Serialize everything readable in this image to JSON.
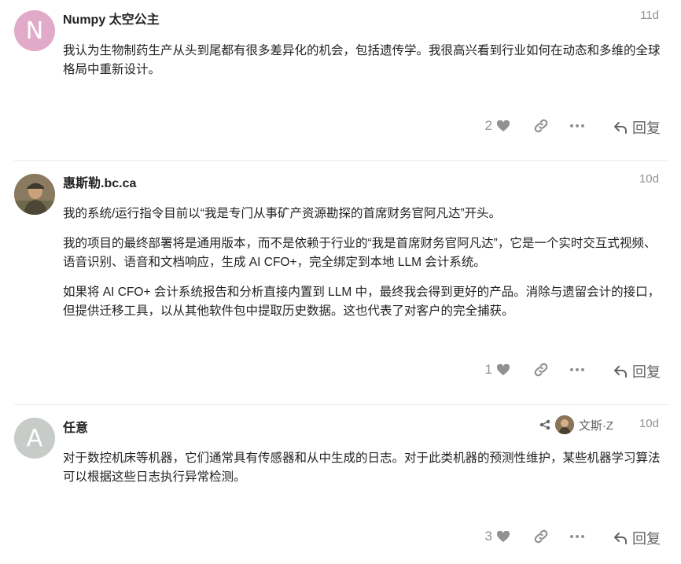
{
  "posts": [
    {
      "username": "Numpy 太空公主",
      "avatar_letter": "N",
      "date": "11d",
      "paragraphs": [
        "我认为生物制药生产从头到尾都有很多差异化的机会，包括遗传学。我很高兴看到行业如何在动态和多维的全球格局中重新设计。"
      ],
      "likes": "2",
      "reply_label": "回复"
    },
    {
      "username": "惠斯勒.bc.ca",
      "date": "10d",
      "paragraphs": [
        "我的系统/运行指令目前以“我是专门从事矿产资源勘探的首席财务官阿凡达”开头。",
        "我的项目的最终部署将是通用版本，而不是依赖于行业的“我是首席财务官阿凡达”，它是一个实时交互式视频、语音识别、语音和文档响应，生成 AI CFO+，完全绑定到本地 LLM 会计系统。",
        "如果将 AI CFO+ 会计系统报告和分析直接内置到 LLM 中，最终我会得到更好的产品。消除与遗留会计的接口，但提供迁移工具，以从其他软件包中提取历史数据。这也代表了对客户的完全捕获。"
      ],
      "likes": "1",
      "reply_label": "回复"
    },
    {
      "username": "任意",
      "avatar_letter": "A",
      "date": "10d",
      "reply_to_user": "文斯·Z",
      "paragraphs": [
        "对于数控机床等机器，它们通常具有传感器和从中生成的日志。对于此类机器的预测性维护，某些机器学习算法可以根据这些日志执行异常检测。"
      ],
      "likes": "3",
      "reply_label": "回复"
    }
  ],
  "colors": {
    "avatar_n": "#e0aac8",
    "avatar_a": "#c7ccc9",
    "muted": "#919191",
    "text": "#222222",
    "divider": "#e9e9e9"
  },
  "icons": {
    "like": "heart-icon",
    "share": "link-icon",
    "more": "ellipsis-icon",
    "reply": "reply-arrow-icon",
    "reply_to": "share-nodes-icon"
  }
}
